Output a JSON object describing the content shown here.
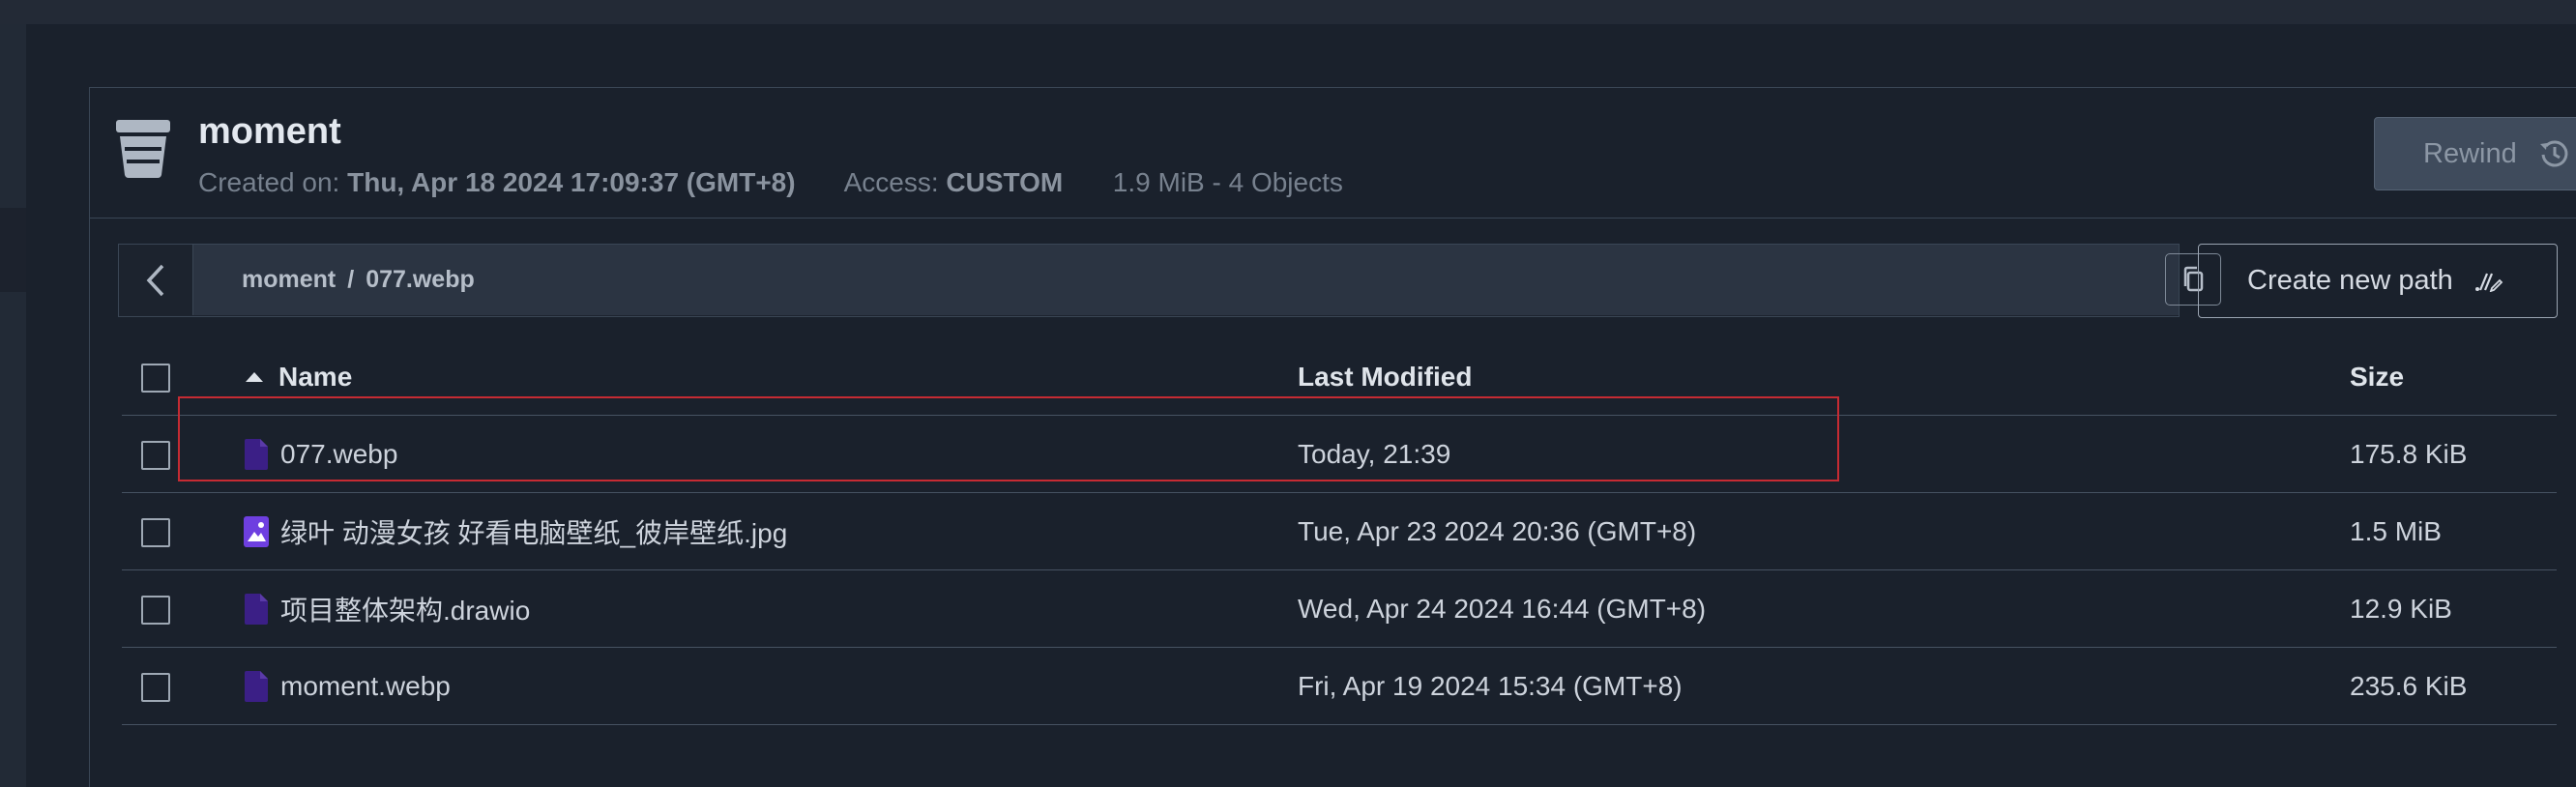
{
  "bucket": {
    "name": "moment",
    "created_label": "Created on:",
    "created_value": "Thu, Apr 18 2024 17:09:37 (GMT+8)",
    "access_label": "Access:",
    "access_value": "CUSTOM",
    "summary": "1.9 MiB - 4 Objects",
    "icon": "bucket-icon"
  },
  "rewind": {
    "label": "Rewind",
    "icon": "history-icon"
  },
  "path": {
    "back_icon": "chevron-left-icon",
    "segments": [
      "moment",
      "077.webp"
    ],
    "separator": "/",
    "copy_icon": "copy-icon"
  },
  "create_path": {
    "label": "Create new path",
    "icon": "new-path-icon"
  },
  "table": {
    "columns": {
      "name": "Name",
      "modified": "Last Modified",
      "size": "Size"
    },
    "sort": {
      "column": "Name",
      "direction": "ascending"
    },
    "rows": [
      {
        "name": "077.webp",
        "modified": "Today, 21:39",
        "size": "175.8 KiB",
        "icon": "file-icon"
      },
      {
        "name": "绿叶 动漫女孩 好看电脑壁纸_彼岸壁纸.jpg",
        "modified": "Tue, Apr 23 2024 20:36 (GMT+8)",
        "size": "1.5 MiB",
        "icon": "image-file-icon"
      },
      {
        "name": "项目整体架构.drawio",
        "modified": "Wed, Apr 24 2024 16:44 (GMT+8)",
        "size": "12.9 KiB",
        "icon": "file-icon"
      },
      {
        "name": "moment.webp",
        "modified": "Fri, Apr 19 2024 15:34 (GMT+8)",
        "size": "235.6 KiB",
        "icon": "file-icon"
      }
    ]
  },
  "colors": {
    "background": "#1a212c",
    "border": "#3a4655",
    "file_icon": "#3b1f86",
    "image_icon": "#6e3fe0",
    "highlight": "#c62b33"
  }
}
